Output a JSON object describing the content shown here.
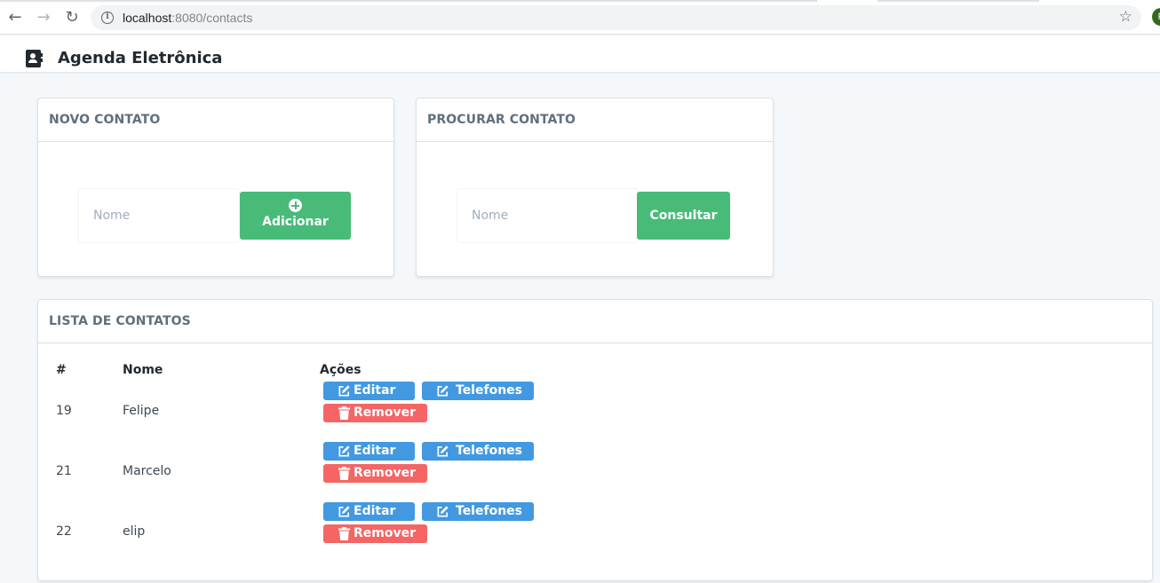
{
  "browser": {
    "url_host": "localhost",
    "url_rest": ":8080/contacts",
    "back_icon": "arrow-left-icon",
    "forward_icon": "arrow-right-icon",
    "reload_icon": "reload-icon",
    "bookmark_icon": "star-icon",
    "profile_initial": "F"
  },
  "app": {
    "title": "Agenda Eletrônica",
    "icon": "address-book-icon"
  },
  "new_contact": {
    "title": "NOVO CONTATO",
    "placeholder": "Nome",
    "button_label": "Adicionar",
    "button_icon": "plus-circle-icon"
  },
  "search_contact": {
    "title": "PROCURAR CONTATO",
    "placeholder": "Nome",
    "button_label": "Consultar"
  },
  "contact_list": {
    "title": "LISTA DE CONTATOS",
    "columns": [
      "#",
      "Nome",
      "Ações"
    ],
    "rows": [
      {
        "id": "19",
        "name": "Felipe"
      },
      {
        "id": "21",
        "name": "Marcelo"
      },
      {
        "id": "22",
        "name": "elip"
      }
    ],
    "actions": {
      "edit": "Editar",
      "phones": "Telefones",
      "remove": "Remover"
    }
  },
  "colors": {
    "success": "#48bb78",
    "primary": "#4299e1",
    "danger": "#f56565",
    "page_bg": "#f5f8fb"
  }
}
